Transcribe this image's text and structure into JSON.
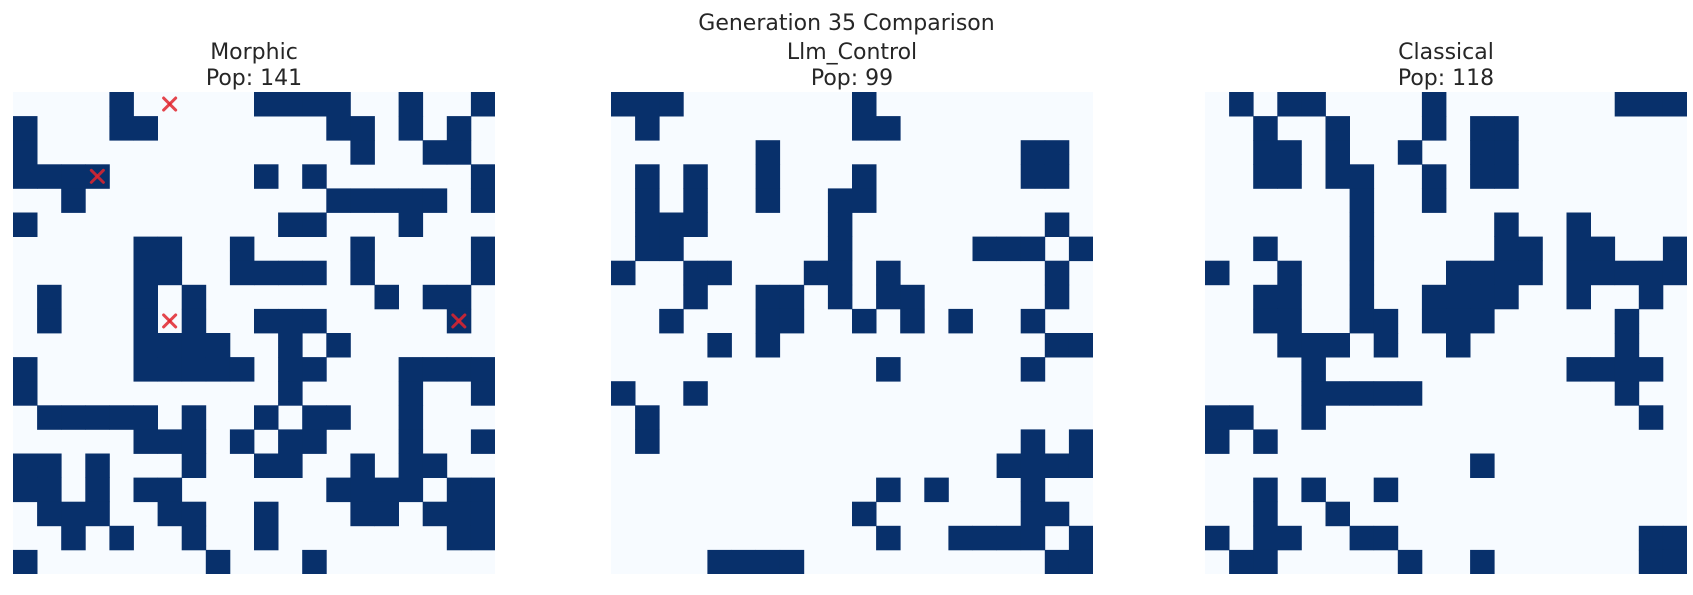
{
  "figure": {
    "suptitle": "Generation 35 Comparison"
  },
  "colors": {
    "alive": "#08306b",
    "dead": "#f7fbff",
    "marker": "#e0242e"
  },
  "chart_data": [
    {
      "type": "heatmap",
      "title_line1": "Morphic",
      "title_line2": "Pop: 141",
      "rows": 20,
      "cols": 20,
      "grid": [
        "....#.....####..#..#",
        "#...##.......##.#.#.",
        "#.............#..##.",
        "####......#.#......#",
        "..#..........#####.#",
        "#..........##...#...",
        ".....##..#....#....#",
        ".....##..####.#....#",
        ".#...#.#.......#.##.",
        ".#...#.#..###.....#.",
        ".....####..#.#......",
        "#....#####.##...####",
        "#..........#....#..#",
        ".#####.#..#.##..#...",
        ".....###.#.##...#..##",
        "##.#...#..##..#.##..",
        "##.#.##......####.##",
        ".###..##..#...##.###",
        "..#.#..#..#.......##",
        "#.......#...#.......",
        "#.......#...#..#...#"
      ],
      "markers": [
        [
          6,
          0
        ],
        [
          3,
          3
        ],
        [
          6,
          9
        ],
        [
          18,
          9
        ]
      ]
    },
    {
      "type": "heatmap",
      "title_line1": "Llm_Control",
      "title_line2": "Pop: 99",
      "rows": 20,
      "cols": 20,
      "grid": [
        "###.......#.........",
        ".#........##........",
        "......#..........##.",
        ".#.#..#...#......##.",
        ".#.#..#..##.........",
        ".###.....#........#.",
        ".##......#.....###.##",
        "#..##...##.#......#.",
        "...#..##.#.##.....#.",
        "..#...##..#.#.#..#..",
        "....#.#...........##",
        "...........#.....#..",
        "#..#................#",
        ".#..................#",
        ".#...............#.#.",
        "................####.",
        "...........#.#...#..",
        "..........#......##.#",
        "...........#..####.#",
        "....####..........##",
        "..###..##......###..",
        "..#..........#......",
        "#..######...........",
        ".##.................#"
      ],
      "markers": []
    },
    {
      "type": "heatmap",
      "title_line1": "Classical",
      "title_line2": "Pop: 118",
      "rows": 20,
      "cols": 20,
      "grid": [
        ".#.##....#.......###",
        "..#..#...#.##.......",
        "..##.#..#..##.......",
        "..##.##..#.##.......",
        "......#..#..........",
        "......#.....#..#....",
        "..#...#.....##.##..#",
        "#..#..#...####.#####",
        "..##..#..####..#..#.",
        "..##..##.###.....#..",
        "...###.#..#......#..",
        "....#..........####.",
        "....#####........#..",
        "##..#.............#.",
        "#.#.................",
        "...........#........",
        "..#.#..#............",
        "..#..#..............",
        "#.##..##..........##",
        ".##.....#..#......##",
        "..#.....##.###.#..#",
        "#.####..##.#.##.##..#"
      ],
      "markers": []
    }
  ]
}
